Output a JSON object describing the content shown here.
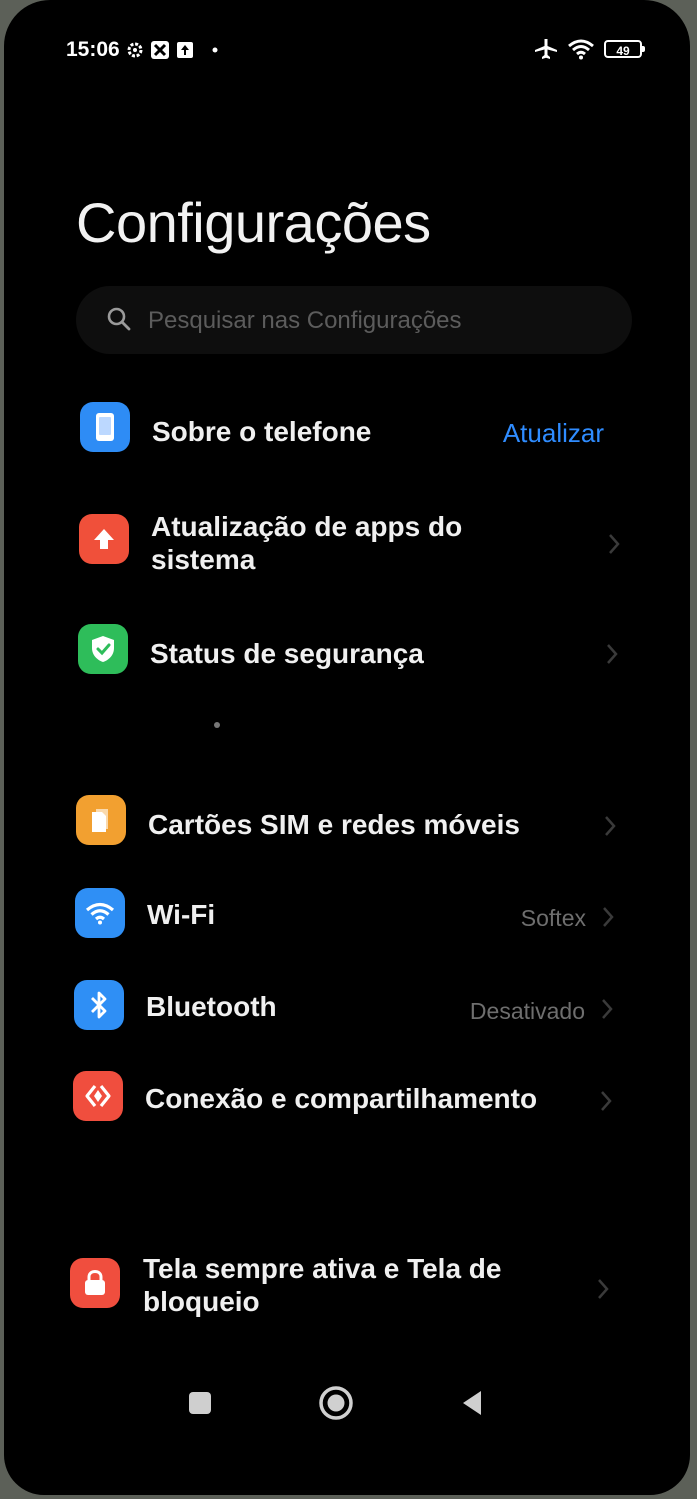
{
  "status_bar": {
    "time": "15:06",
    "battery": "49",
    "left_icons": [
      "settings-gear-icon",
      "app-notification-icon",
      "upload-icon",
      "dot-icon"
    ],
    "right_icons": [
      "airplane-icon",
      "wifi-icon",
      "battery-icon"
    ]
  },
  "page": {
    "title": "Configurações"
  },
  "search": {
    "placeholder": "Pesquisar nas Configurações"
  },
  "items": [
    {
      "label": "Sobre o telefone",
      "action": "Atualizar",
      "icon": "phone-icon",
      "color": "#2e8cf5"
    },
    {
      "label": "Atualização de apps do sistema",
      "icon": "up-arrow-icon",
      "color": "#f0503a"
    },
    {
      "label": "Status de segurança",
      "icon": "shield-check-icon",
      "color": "#2ebd5a"
    },
    {
      "label": "Cartões SIM e redes móveis",
      "icon": "sim-card-icon",
      "color": "#f2a030"
    },
    {
      "label": "Wi-Fi",
      "value": "Softex",
      "icon": "wifi-icon",
      "color": "#2f8ff5"
    },
    {
      "label": "Bluetooth",
      "value": "Desativado",
      "icon": "bluetooth-icon",
      "color": "#2f8ff5"
    },
    {
      "label": "Conexão e compartilhamento",
      "icon": "connection-share-icon",
      "color": "#f04e3e"
    },
    {
      "label": "Tela sempre ativa e Tela de bloqueio",
      "icon": "lock-icon",
      "color": "#f04e3e"
    }
  ],
  "nav": {
    "icons": [
      "recents-square-icon",
      "home-circle-icon",
      "back-triangle-icon"
    ]
  },
  "colors": {
    "accent": "#2f8cff",
    "background": "#000000"
  }
}
